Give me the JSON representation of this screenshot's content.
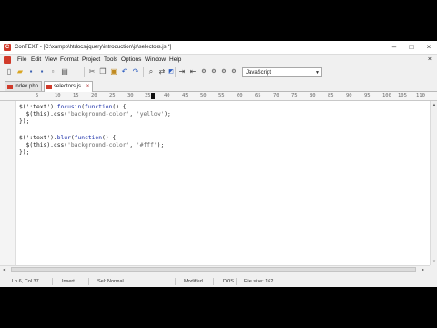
{
  "window": {
    "title": "ConTEXT - [C:\\xampp\\htdocs\\jquery\\introduction\\js\\selectors.js *]",
    "controls": [
      "–",
      "□",
      "×"
    ]
  },
  "menu": [
    "File",
    "Edit",
    "View",
    "Format",
    "Project",
    "Tools",
    "Options",
    "Window",
    "Help"
  ],
  "toolbar": {
    "language": "JavaScript",
    "icons": [
      "new-file-icon",
      "open-folder-icon",
      "save-icon",
      "save-all-icon",
      "close-file-icon",
      "print-icon",
      "cut-icon",
      "copy-icon",
      "paste-icon",
      "undo-icon",
      "redo-icon",
      "find-icon",
      "replace-icon",
      "word-wrap-icon",
      "indent-icon",
      "outdent-icon",
      "execute-1-icon",
      "execute-2-icon",
      "execute-3-icon",
      "execute-4-icon"
    ]
  },
  "tabs": [
    {
      "label": "index.php",
      "active": false
    },
    {
      "label": "selectors.js",
      "active": true
    }
  ],
  "ruler": [
    "5",
    "10",
    "15",
    "20",
    "25",
    "30",
    "35",
    "40",
    "45",
    "50",
    "55",
    "60",
    "65",
    "70",
    "75",
    "80",
    "85",
    "90",
    "95",
    "100",
    "105",
    "110"
  ],
  "code": {
    "line1": {
      "a": "$(':text').",
      "b": "focusin",
      "c": "(",
      "d": "function",
      "e": "() {"
    },
    "line2": {
      "a": "  $(this).css(",
      "b": "'background-color'",
      "c": ", ",
      "d": "'yellow'",
      "e": ");"
    },
    "line3": "});",
    "line5": {
      "a": "$(':text').",
      "b": "blur",
      "c": "(",
      "d": "function",
      "e": "() {"
    },
    "line6": {
      "a": "  $(this).css(",
      "b": "'background-color'",
      "c": ", ",
      "d": "'#fff'",
      "e": ");"
    },
    "line7": "});"
  },
  "status": {
    "position": "Ln 6, Col 37",
    "mode": "Insert",
    "selection": "Sel: Normal",
    "modified": "Modified",
    "format": "DOS",
    "filesize": "File size: 162"
  },
  "colors": {
    "keyword": "#1a2ea8",
    "app_icon": "#d03a2a"
  }
}
